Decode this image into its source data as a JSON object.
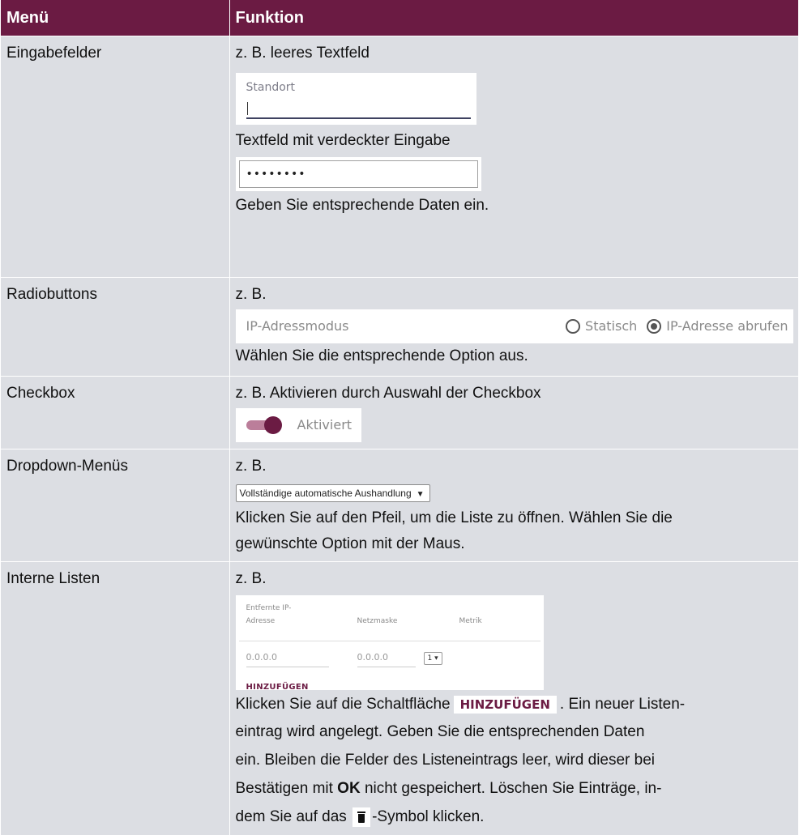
{
  "table": {
    "headers": [
      "Menü",
      "Funktion"
    ],
    "rows": {
      "eingabe": {
        "menu": "Eingabefelder",
        "line1": "z. B. leeres Textfeld",
        "demo_label": "Standort",
        "line2": "Textfeld mit verdeckter Eingabe",
        "demo_password": "••••••••",
        "line3": "Geben Sie entsprechende Daten ein."
      },
      "radio": {
        "menu": "Radiobuttons",
        "line1": "z. B.",
        "demo_label": "IP-Adressmodus",
        "option1": "Statisch",
        "option2": "IP-Adresse abrufen",
        "line2": "Wählen Sie die entsprechende Option aus."
      },
      "checkbox": {
        "menu": "Checkbox",
        "line1": "z. B. Aktivieren durch Auswahl der Checkbox",
        "demo_label": "Aktiviert"
      },
      "dropdown": {
        "menu": "Dropdown-Menüs",
        "line1": "z. B.",
        "demo_value": "Vollständige automatische Aushandlung",
        "line2a": "Klicken Sie auf den Pfeil, um die Liste zu öffnen. Wählen Sie die",
        "line2b": "gewünschte Option mit der Maus."
      },
      "listen": {
        "menu": "Interne Listen",
        "line1": "z. B.",
        "col1a": "Entfernte IP-",
        "col1b": "Adresse",
        "col2": "Netzmaske",
        "col3": "Metrik",
        "val1": "0.0.0.0",
        "val2": "0.0.0.0",
        "val3": "1",
        "add_label": "HINZUFÜGEN",
        "text_a": "Klicken Sie auf die Schaltfläche",
        "button_label": "HINZUFÜGEN",
        "text_b": ". Ein neuer Listen-",
        "line_c": "eintrag wird angelegt. Geben Sie die entsprechenden Daten",
        "line_d": "ein. Bleiben die Felder des Listeneintrags leer, wird dieser bei",
        "text_e1": "Bestätigen mit ",
        "text_e_bold": "OK",
        "text_e2": " nicht gespeichert. Löschen Sie Einträge, in-",
        "text_f1": "dem Sie auf das ",
        "text_f2": "-Symbol klicken."
      }
    }
  },
  "colors": {
    "header_bg": "#6b1b43",
    "cell_bg": "#dcdee3",
    "accent": "#6b1b43"
  }
}
